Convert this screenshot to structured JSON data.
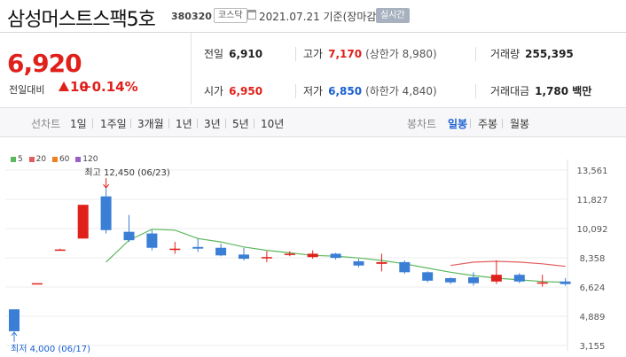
{
  "header": {
    "name": "삼성머스트스팩5호",
    "code": "380320",
    "market": "코스닥",
    "date": "2021.07.21 기준(장마감)",
    "realtime": "실시간"
  },
  "price": {
    "current": "6,920",
    "change_label": "전일대비",
    "change_value": "10",
    "change_pct": "+0.14%"
  },
  "stats": {
    "prev": {
      "label": "전일",
      "value": "6,910"
    },
    "high": {
      "label": "고가",
      "value": "7,170",
      "limit": "(상한가 8,980)"
    },
    "volume": {
      "label": "거래량",
      "value": "255,395"
    },
    "open": {
      "label": "시가",
      "value": "6,950"
    },
    "low": {
      "label": "저가",
      "value": "6,850",
      "limit": "(하한가 4,840)"
    },
    "amount": {
      "label": "거래대금",
      "value": "1,780 백만"
    }
  },
  "tabs": {
    "line_label": "선차트",
    "line_items": [
      "1일",
      "1주일",
      "3개월",
      "1년",
      "3년",
      "5년",
      "10년"
    ],
    "candle_label": "봉차트",
    "candle_items": [
      "일봉",
      "주봉",
      "월봉"
    ],
    "candle_active": "일봉"
  },
  "colors": {
    "up": "#e0201b",
    "down": "#3a7fd5",
    "ma5": "#5cb85c",
    "ma20": "#e35d5d",
    "ma60": "#f07f1d",
    "ma120": "#9a5fc5"
  },
  "chart_data": {
    "type": "candlestick",
    "legend": [
      "5",
      "20",
      "60",
      "120"
    ],
    "yticks": [
      "13,561",
      "11,827",
      "10,092",
      "8,358",
      "6,624",
      "4,889",
      "3,155"
    ],
    "ylim": [
      3155,
      13561
    ],
    "annotations": {
      "high": "최고 12,450 (06/23)",
      "low": "최저 4,000 (06/17)"
    },
    "candles": [
      {
        "o": 5300,
        "c": 4000,
        "h": 5300,
        "l": 4000
      },
      {
        "o": 6850,
        "c": 6850,
        "h": 6850,
        "l": 6850
      },
      {
        "o": 8850,
        "c": 8850,
        "h": 8900,
        "l": 8800
      },
      {
        "o": 9500,
        "c": 11500,
        "h": 11500,
        "l": 9500
      },
      {
        "o": 12000,
        "c": 10000,
        "h": 12450,
        "l": 9800
      },
      {
        "o": 9900,
        "c": 9400,
        "h": 10900,
        "l": 9300
      },
      {
        "o": 9800,
        "c": 8950,
        "h": 10000,
        "l": 8800
      },
      {
        "o": 8900,
        "c": 8900,
        "h": 9300,
        "l": 8600
      },
      {
        "o": 9000,
        "c": 8900,
        "h": 9500,
        "l": 8700
      },
      {
        "o": 8950,
        "c": 8500,
        "h": 9200,
        "l": 8450
      },
      {
        "o": 8550,
        "c": 8300,
        "h": 8950,
        "l": 8200
      },
      {
        "o": 8400,
        "c": 8400,
        "h": 8750,
        "l": 8100
      },
      {
        "o": 8600,
        "c": 8600,
        "h": 8750,
        "l": 8450
      },
      {
        "o": 8400,
        "c": 8600,
        "h": 8800,
        "l": 8300
      },
      {
        "o": 8600,
        "c": 8350,
        "h": 8650,
        "l": 8250
      },
      {
        "o": 8150,
        "c": 7900,
        "h": 8300,
        "l": 7800
      },
      {
        "o": 8000,
        "c": 8100,
        "h": 8600,
        "l": 7550
      },
      {
        "o": 8100,
        "c": 7500,
        "h": 8200,
        "l": 7400
      },
      {
        "o": 7500,
        "c": 7000,
        "h": 7550,
        "l": 6900
      },
      {
        "o": 7150,
        "c": 6900,
        "h": 7200,
        "l": 6800
      },
      {
        "o": 7200,
        "c": 6850,
        "h": 7500,
        "l": 6700
      },
      {
        "o": 6950,
        "c": 7350,
        "h": 8200,
        "l": 6800
      },
      {
        "o": 7350,
        "c": 6950,
        "h": 7450,
        "l": 6850
      },
      {
        "o": 6900,
        "c": 6900,
        "h": 7350,
        "l": 6650
      },
      {
        "o": 6950,
        "c": 6800,
        "h": 7150,
        "l": 6700
      }
    ],
    "ma5": [
      null,
      null,
      null,
      null,
      8100,
      9400,
      10050,
      10000,
      9500,
      9300,
      9000,
      8800,
      8650,
      8500,
      8450,
      8350,
      8200,
      8000,
      7750,
      7500,
      7300,
      7150,
      7050,
      6950,
      6900
    ],
    "ma20": [
      null,
      null,
      null,
      null,
      null,
      null,
      null,
      null,
      null,
      null,
      null,
      null,
      null,
      null,
      null,
      null,
      null,
      null,
      null,
      7900,
      8100,
      8150,
      8100,
      8000,
      7850
    ]
  }
}
